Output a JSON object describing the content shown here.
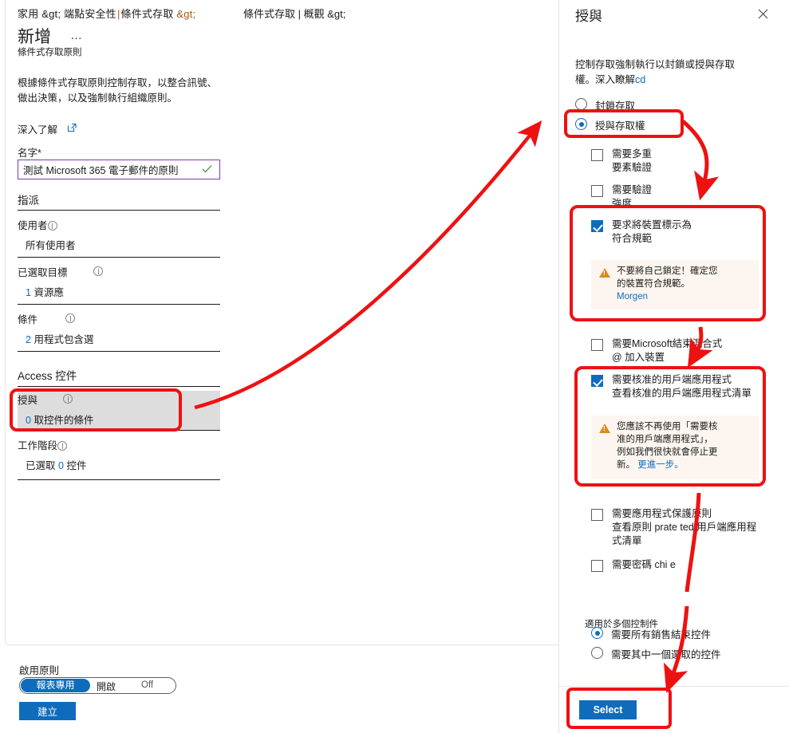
{
  "left": {
    "breadcrumb_a": "家用 &gt;",
    "breadcrumb_b": "端點安全性",
    "breadcrumb_pipe": "|",
    "breadcrumb_c": "條件式存取",
    "breadcrumb_d": "&gt;",
    "breadcrumb2": "條件式存取 | 概觀 &gt;",
    "page_title": "新增",
    "title_ellipsis": "…",
    "subtitle": "條件式存取原則",
    "description": "根據條件式存取原則控制存取，以整合訊號、做出決策，以及強制執行組織原則。",
    "learn_more": "深入了解",
    "external_link_icon": "external-link-icon",
    "name_label": "名字",
    "name_required_mark": "*",
    "name_value": "測試 Microsoft 365 電子郵件的原則",
    "name_valid_icon": "check-icon",
    "assign_header": "指派",
    "users_label": "使用者",
    "users_value": "所有使用者",
    "target_label": "已選取目標",
    "target_value_num": "1",
    "target_value_text": "資源應",
    "condition_label": "條件",
    "condition_value_num": "2",
    "condition_value_text": "用程式包含選",
    "access_controls_header": "Access 控件",
    "grant_label": "授與",
    "grant_value_num": "0",
    "grant_value_text": "取控件的條件",
    "session_label": "工作階段",
    "session_value_pre": "已選取",
    "session_value_num": "0",
    "session_value_post": "控件",
    "enable_policy_label": "啟用原則",
    "toggle_report_only": "報表專用",
    "toggle_on": "開啟",
    "toggle_off": "Off",
    "create_button": "建立"
  },
  "panel": {
    "title": "授與",
    "close_icon": "close-icon",
    "description_line1": "控制存取強制執行以封鎖或授與",
    "description_line2": "存取權。深入瞭解",
    "description_link": "cd",
    "radio_block": "封鎖存取",
    "radio_grant": "授與存取權",
    "controls": [
      {
        "id": "mfa",
        "label_line1": "需要多重",
        "label_line2": "要素驗證",
        "checked": false,
        "info_icon": "info-icon"
      },
      {
        "id": "auth-strength",
        "label_line1": "需要驗證",
        "label_line2": "強度",
        "checked": false,
        "info_icon": "info-icon"
      },
      {
        "id": "device-compliant",
        "label_line1": "要求將裝置標示為",
        "label_line2": "符合規範",
        "checked": true,
        "info_icon": "info-icon",
        "warning": "不要將自己鎖定！確定您的裝置符合規範。",
        "warning_link": "Morgen"
      },
      {
        "id": "hybrid-join",
        "label_line1": "需要Microsoft結束混合式",
        "label_line2": "@ 加入裝置",
        "checked": false,
        "info_icon": null
      },
      {
        "id": "approved-client-app",
        "label_line1": "需要核准的用戶端應用程式",
        "label_line2": "查看核准的用戶端應用程式清單",
        "checked": true,
        "info_icon": "info-icon",
        "warning": "您應該不再使用「需要核准的用戶端應用程式」，例如我們很快就會停止更新。",
        "warning_link": "更進一步。"
      },
      {
        "id": "app-protection-policy",
        "label_line1": "需要應用程式保護原則",
        "label_line2": "查看原則 prate ted 用戶端應用程",
        "label_line3": "式清單",
        "checked": false,
        "info_icon": "info-icon"
      },
      {
        "id": "password-change",
        "label_line1": "需要密碼 chi e",
        "checked": false,
        "info_icon": "info-icon"
      }
    ],
    "multi_control_label": "適用於多個控制件",
    "multi_all": "需要所有銷售結束控件",
    "multi_one": "需要其中一個選取的控件",
    "multi_selected": "all",
    "select_button": "Select"
  },
  "annotations": {
    "accent_color": "#ee1111",
    "highlight_boxes": [
      "grant-row-left",
      "grant-access-radio",
      "device-compliant-control",
      "approved-client-app-control",
      "select-button"
    ],
    "arrows": [
      "grant-row-to-grant-radio",
      "grant-radio-to-device-compliant",
      "device-compliant-to-approved-app",
      "approved-app-to-select-button"
    ]
  }
}
